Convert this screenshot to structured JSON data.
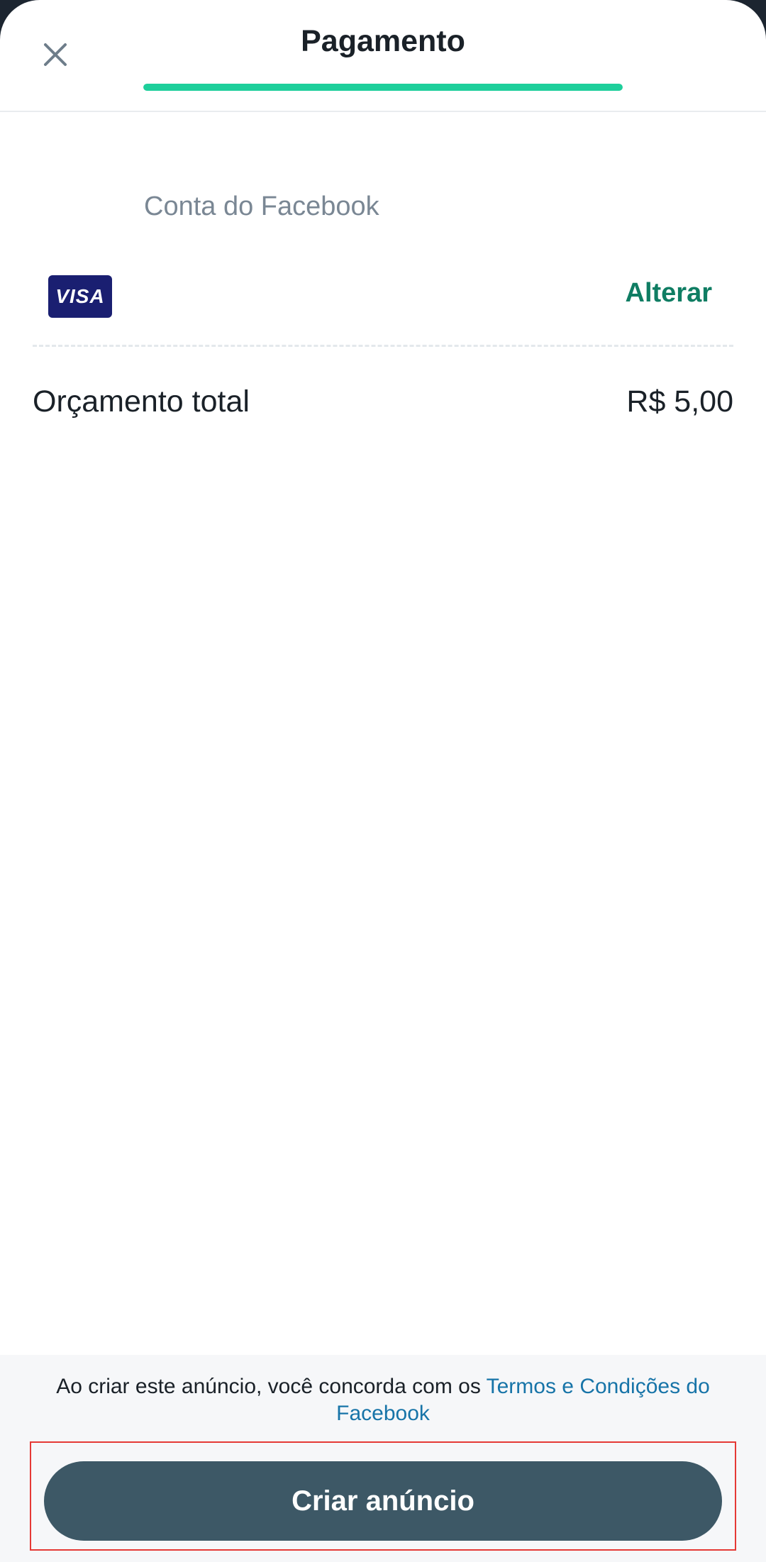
{
  "header": {
    "title": "Pagamento",
    "close_icon": "close-icon",
    "progress_fraction": 1.0
  },
  "account": {
    "label": "Conta do Facebook"
  },
  "payment_method": {
    "card_brand": "VISA",
    "change_label": "Alterar"
  },
  "budget": {
    "label": "Orçamento total",
    "value": "R$ 5,00"
  },
  "footer": {
    "terms_prefix": "Ao criar este anúncio, você concorda com os ",
    "terms_link": "Termos e Condições do Facebook",
    "create_button": "Criar anúncio"
  },
  "colors": {
    "accent": "#1ecf9b",
    "link": "#0f7d63",
    "terms_link": "#1774a8",
    "primary_button": "#3d5866",
    "visa_blue": "#1a1f71"
  }
}
